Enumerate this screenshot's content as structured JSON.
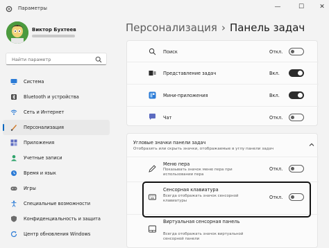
{
  "window": {
    "title": "Параметры",
    "minimize": "—",
    "maximize": "☐",
    "close": "✕"
  },
  "profile": {
    "name": "Виктор Бухтеев"
  },
  "search": {
    "placeholder": "Найти параметр"
  },
  "sidebar": {
    "items": [
      {
        "label": "Система",
        "icon": "monitor-icon"
      },
      {
        "label": "Bluetooth и устройства",
        "icon": "bluetooth-icon"
      },
      {
        "label": "Сеть и Интернет",
        "icon": "wifi-icon"
      },
      {
        "label": "Персонализация",
        "icon": "brush-icon",
        "active": true
      },
      {
        "label": "Приложения",
        "icon": "apps-icon"
      },
      {
        "label": "Учетные записи",
        "icon": "person-icon"
      },
      {
        "label": "Время и язык",
        "icon": "globe-clock-icon"
      },
      {
        "label": "Игры",
        "icon": "gamepad-icon"
      },
      {
        "label": "Специальные возможности",
        "icon": "accessibility-icon"
      },
      {
        "label": "Конфиденциальность и защита",
        "icon": "shield-icon"
      },
      {
        "label": "Центр обновления Windows",
        "icon": "update-icon"
      }
    ]
  },
  "header": {
    "parent": "Персонализация",
    "separator": "›",
    "current": "Панель задач"
  },
  "taskbar_items": [
    {
      "label": "Поиск",
      "value": "Откл.",
      "on": false,
      "icon": "search-icon"
    },
    {
      "label": "Представление задач",
      "value": "Вкл.",
      "on": true,
      "icon": "task-view-icon"
    },
    {
      "label": "Мини-приложения",
      "value": "Вкл.",
      "on": true,
      "icon": "widgets-icon"
    },
    {
      "label": "Чат",
      "value": "Откл.",
      "on": false,
      "icon": "chat-icon"
    }
  ],
  "corner_section": {
    "title": "Угловые значки панели задач",
    "subtitle": "Отобразить или скрыть значки, отображаемые в углу панели задач",
    "items": [
      {
        "label": "Меню пера",
        "desc": "Показывать значок меню пера при использовании пера",
        "value": "Откл.",
        "on": false,
        "icon": "pen-icon"
      },
      {
        "label": "Сенсорная клавиатура",
        "desc": "Всегда отображать значок сенсорной клавиатуры",
        "value": "Откл.",
        "on": false,
        "icon": "keyboard-icon"
      },
      {
        "label": "Виртуальная сенсорная панель",
        "desc": "Всегда отображать значок виртуальной сенсорной панели",
        "value": "",
        "on": false,
        "icon": "touchpad-icon"
      }
    ]
  },
  "colors": {
    "accent": "#0067c0",
    "toggle_on": "#2b2b2b",
    "background": "#f3f3f3"
  }
}
